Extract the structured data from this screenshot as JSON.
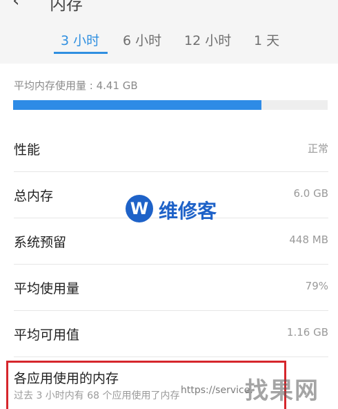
{
  "header": {
    "back_icon": "back-arrow-icon",
    "title": "内存"
  },
  "tabs": [
    {
      "label": "3 小时",
      "active": true
    },
    {
      "label": "6 小时",
      "active": false
    },
    {
      "label": "12 小时",
      "active": false
    },
    {
      "label": "1 天",
      "active": false
    }
  ],
  "summary": {
    "avg_label": "平均内存使用量 : 4.41 GB",
    "usage_fraction": 0.79
  },
  "rows": [
    {
      "label": "性能",
      "value": "正常"
    },
    {
      "label": "总内存",
      "value": "6.0 GB"
    },
    {
      "label": "系统预留",
      "value": "448 MB"
    },
    {
      "label": "平均使用量",
      "value": "79%"
    },
    {
      "label": "平均可用值",
      "value": "1.16 GB"
    }
  ],
  "apps": {
    "title": "各应用使用的内存",
    "subtitle": "过去 3 小时内有 68 个应用使用了内存"
  },
  "watermarks": {
    "center_logo_letter": "W",
    "center_text": "维修客",
    "url_text": "https://service.",
    "brand_text": "找果网"
  },
  "colors": {
    "accent": "#2f8fe0",
    "bar_fill": "#2e8be6",
    "highlight_border": "#d6262c"
  }
}
